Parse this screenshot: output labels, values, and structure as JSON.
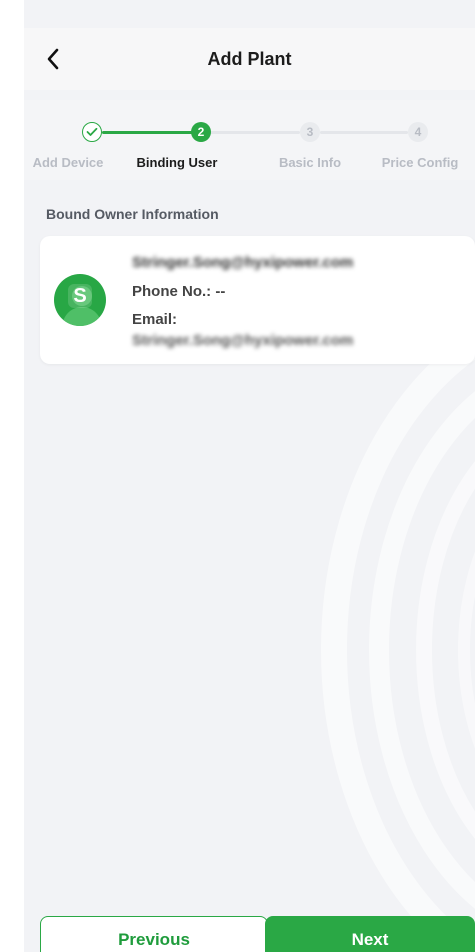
{
  "header": {
    "title": "Add Plant",
    "back_icon": "chevron-left-icon"
  },
  "stepper": {
    "current_step": 2,
    "steps": [
      {
        "number": "",
        "label": "Add Device",
        "state": "completed",
        "icon": "check-circle-icon"
      },
      {
        "number": "2",
        "label": "Binding User",
        "state": "active"
      },
      {
        "number": "3",
        "label": "Basic Info",
        "state": "pending"
      },
      {
        "number": "4",
        "label": "Price Config",
        "state": "pending"
      }
    ]
  },
  "owner": {
    "section_title": "Bound Owner Information",
    "avatar_letter": "S",
    "name": "Stringer.Song@hyxipower.com",
    "phone": "Phone No.: --",
    "email_label": "Email:",
    "email": "Stringer.Song@hyxipower.com"
  },
  "footer": {
    "previous_label": "Previous",
    "next_label": "Next"
  },
  "colors": {
    "accent": "#2aa845",
    "inactive": "#b8bcc4",
    "background": "#f2f3f6"
  }
}
